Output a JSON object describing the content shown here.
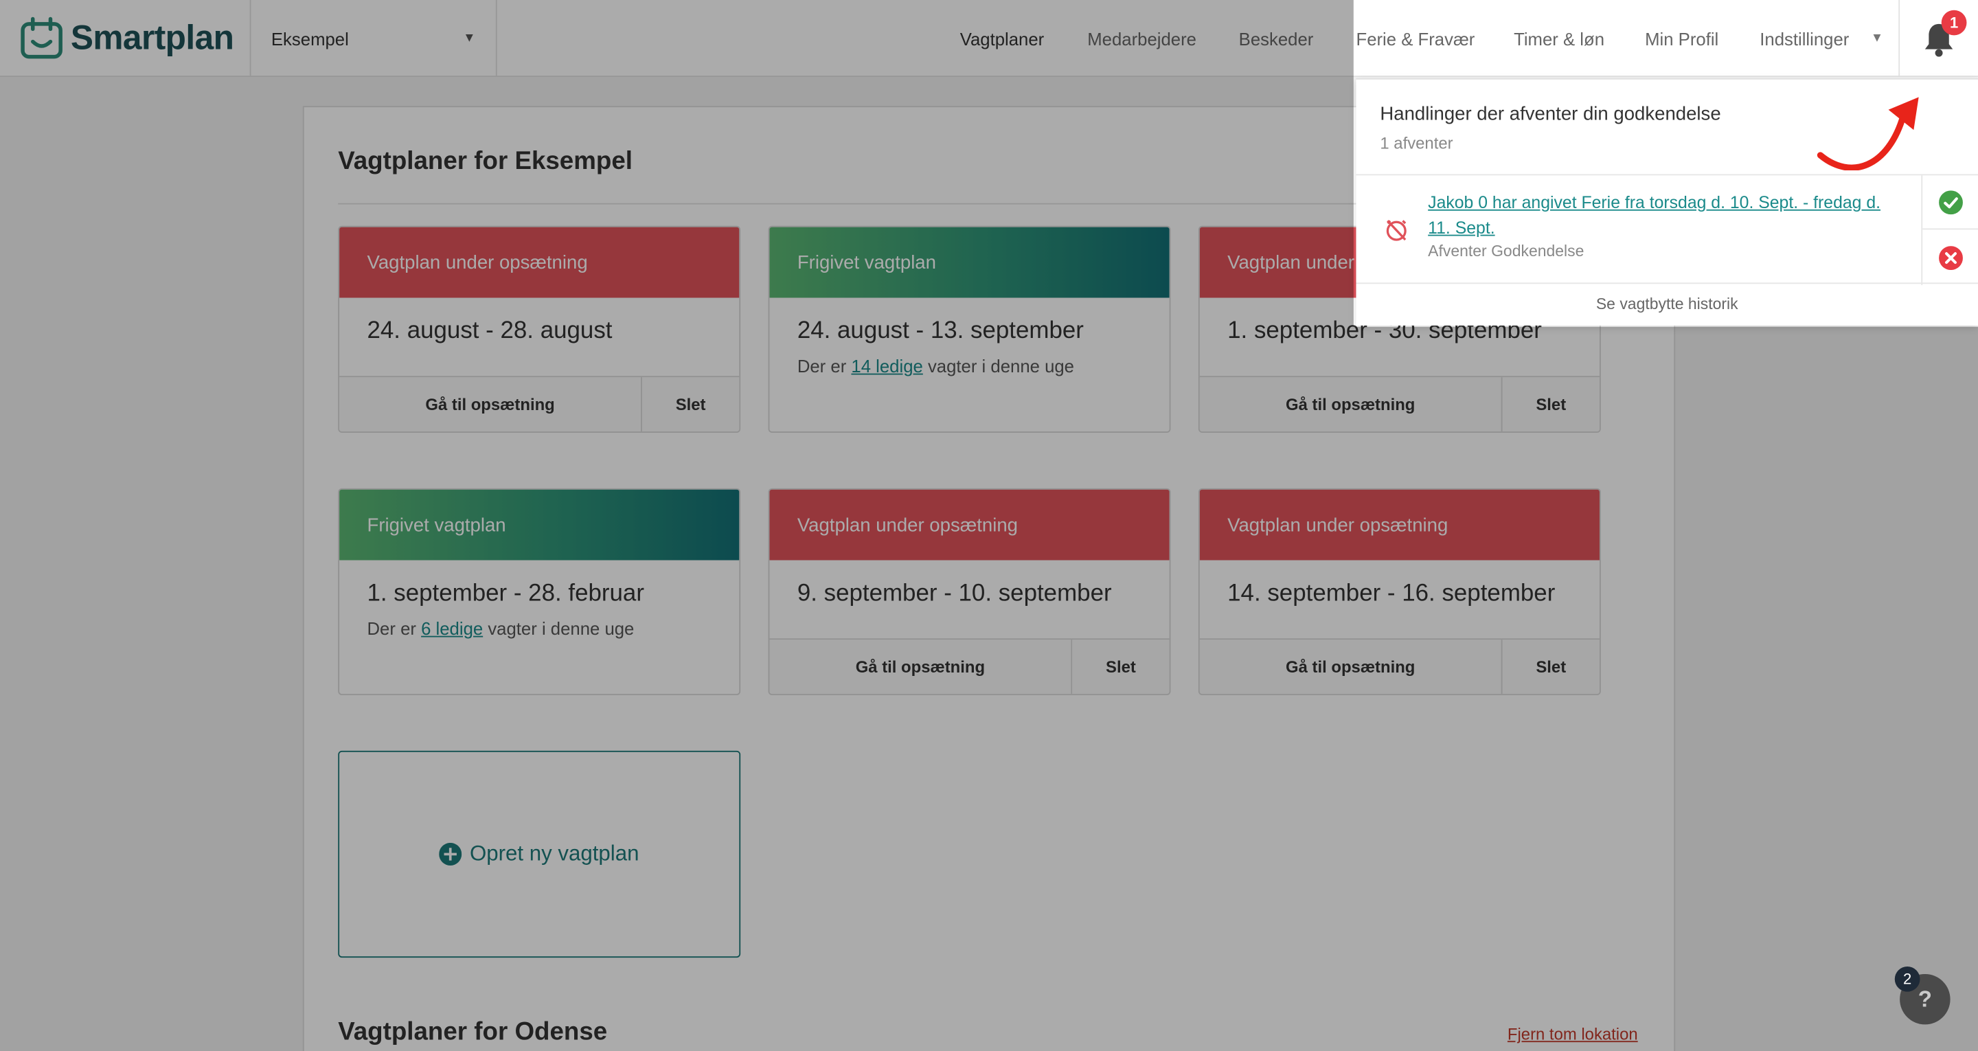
{
  "app": {
    "name": "Smartplan"
  },
  "header": {
    "location_select": "Eksempel",
    "nav": [
      "Vagtplaner",
      "Medarbejdere",
      "Beskeder",
      "Ferie & Fravær",
      "Timer & løn",
      "Min Profil",
      "Indstillinger"
    ],
    "notification_count": "1"
  },
  "main": {
    "section1_title": "Vagtplaner for Eksempel",
    "section2_title": "Vagtplaner for Odense",
    "remove_location": "Fjern tom lokation",
    "new_plan": "Opret ny vagtplan",
    "cards": [
      {
        "status": "Vagtplan under opsætning",
        "range": "24. august - 28. august",
        "btn_setup": "Gå til opsætning",
        "btn_delete": "Slet"
      },
      {
        "status": "Frigivet vagtplan",
        "range": "24. august - 13. september",
        "sub_pre": "Der er",
        "sub_link": "14 ledige",
        "sub_post": "vagter i denne uge"
      },
      {
        "status": "Vagtplan under opsætning",
        "range": "1. september - 30. september",
        "btn_setup": "Gå til opsætning",
        "btn_delete": "Slet"
      },
      {
        "status": "Frigivet vagtplan",
        "range": "1. september - 28. februar",
        "sub_pre": "Der er",
        "sub_link": "6 ledige",
        "sub_post": "vagter i denne uge"
      },
      {
        "status": "Vagtplan under opsætning",
        "range": "9. september - 10. september",
        "btn_setup": "Gå til opsætning",
        "btn_delete": "Slet"
      },
      {
        "status": "Vagtplan under opsætning",
        "range": "14. september - 16. september",
        "btn_setup": "Gå til opsætning",
        "btn_delete": "Slet"
      }
    ]
  },
  "notifications": {
    "title": "Handlinger der afventer din godkendelse",
    "count_text": "1 afventer",
    "items": [
      {
        "text": "Jakob 0 har angivet Ferie fra torsdag d. 10. Sept. - fredag d. 11. Sept.",
        "status": "Afventer Godkendelse"
      }
    ],
    "footer": "Se vagtbytte historik"
  },
  "help": {
    "badge": "2",
    "icon": "?"
  },
  "colors": {
    "brand": "#1f5157",
    "accent": "#1a8a8a",
    "red": "#e0525a",
    "danger": "#e83b44",
    "success": "#43a047"
  }
}
